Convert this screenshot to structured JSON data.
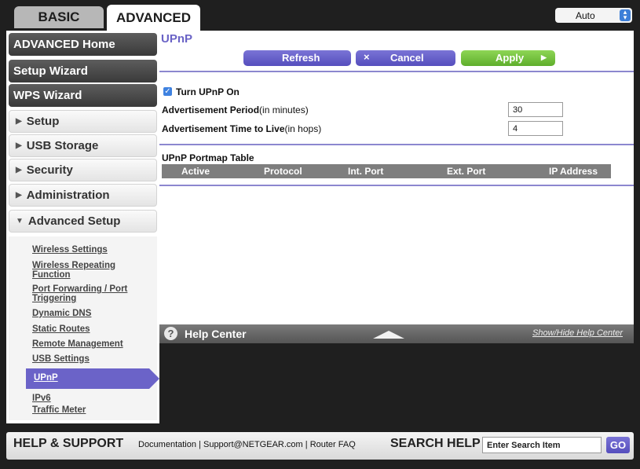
{
  "tabs": {
    "basic": "BASIC",
    "advanced": "ADVANCED"
  },
  "language": {
    "value": "Auto"
  },
  "sidebar": {
    "dark_buttons": [
      "ADVANCED Home",
      "Setup Wizard",
      "WPS Wizard"
    ],
    "sections": [
      "Setup",
      "USB Storage",
      "Security",
      "Administration",
      "Advanced Setup"
    ],
    "sub_items": [
      "Wireless Settings",
      "Wireless Repeating Function",
      "Port Forwarding / Port Triggering",
      "Dynamic DNS",
      "Static Routes",
      "Remote Management",
      "USB Settings",
      "UPnP",
      "IPv6",
      "Traffic Meter"
    ],
    "active_item": "UPnP"
  },
  "main": {
    "title": "UPnP",
    "buttons": {
      "refresh": "Refresh",
      "cancel": "Cancel",
      "apply": "Apply"
    },
    "turn_on_label": "Turn UPnP On",
    "turn_on_checked": true,
    "adv_period_label": "Advertisement Period",
    "adv_period_unit": "(in minutes)",
    "adv_period_value": "30",
    "adv_ttl_label": "Advertisement Time to Live",
    "adv_ttl_unit": "(in hops)",
    "adv_ttl_value": "4",
    "table_title": "UPnP Portmap Table",
    "table_headers": [
      "Active",
      "Protocol",
      "Int. Port",
      "Ext. Port",
      "IP Address"
    ]
  },
  "help_center": {
    "title": "Help Center",
    "toggle": "Show/Hide Help Center"
  },
  "footer": {
    "title": "HELP & SUPPORT",
    "links": [
      "Documentation",
      "Support@NETGEAR.com",
      "Router FAQ"
    ],
    "search_label": "SEARCH HELP",
    "search_placeholder": "Enter Search Item",
    "go": "GO"
  },
  "colors": {
    "accent": "#6a63c6",
    "apply": "#74c23e",
    "dark": "#1f1f1f"
  }
}
